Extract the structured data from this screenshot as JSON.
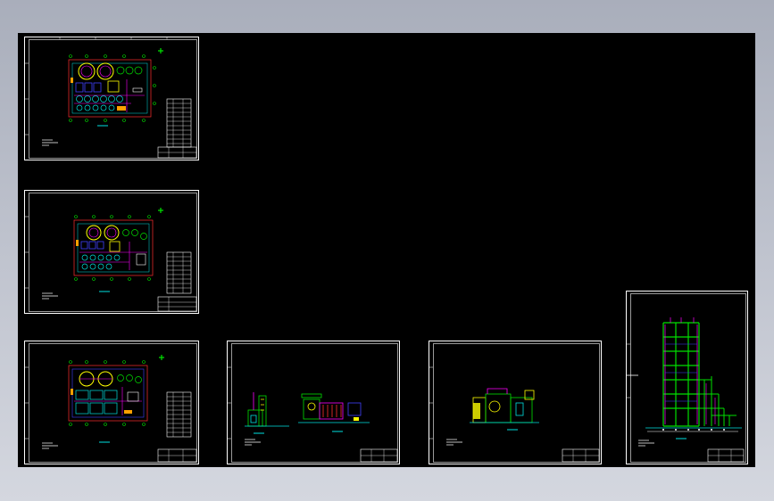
{
  "app": {
    "viewport_name": "cad-model-space",
    "background": "#000000",
    "frame_background": "#b6bac5"
  },
  "colors": {
    "frame": "#ffffff",
    "green": "#00e000",
    "cyan": "#00e0e0",
    "yellow": "#ffff00",
    "magenta": "#ff00ff",
    "red": "#ff3030",
    "blue": "#4040ff",
    "orange": "#ffa000"
  },
  "sheets": [
    {
      "id": "sheet-plan-1",
      "type": "plan"
    },
    {
      "id": "sheet-plan-2",
      "type": "plan"
    },
    {
      "id": "sheet-plan-3",
      "type": "plan"
    },
    {
      "id": "sheet-elevation-1",
      "type": "elevation"
    },
    {
      "id": "sheet-elevation-2",
      "type": "elevation"
    },
    {
      "id": "sheet-section-tower",
      "type": "section"
    }
  ]
}
